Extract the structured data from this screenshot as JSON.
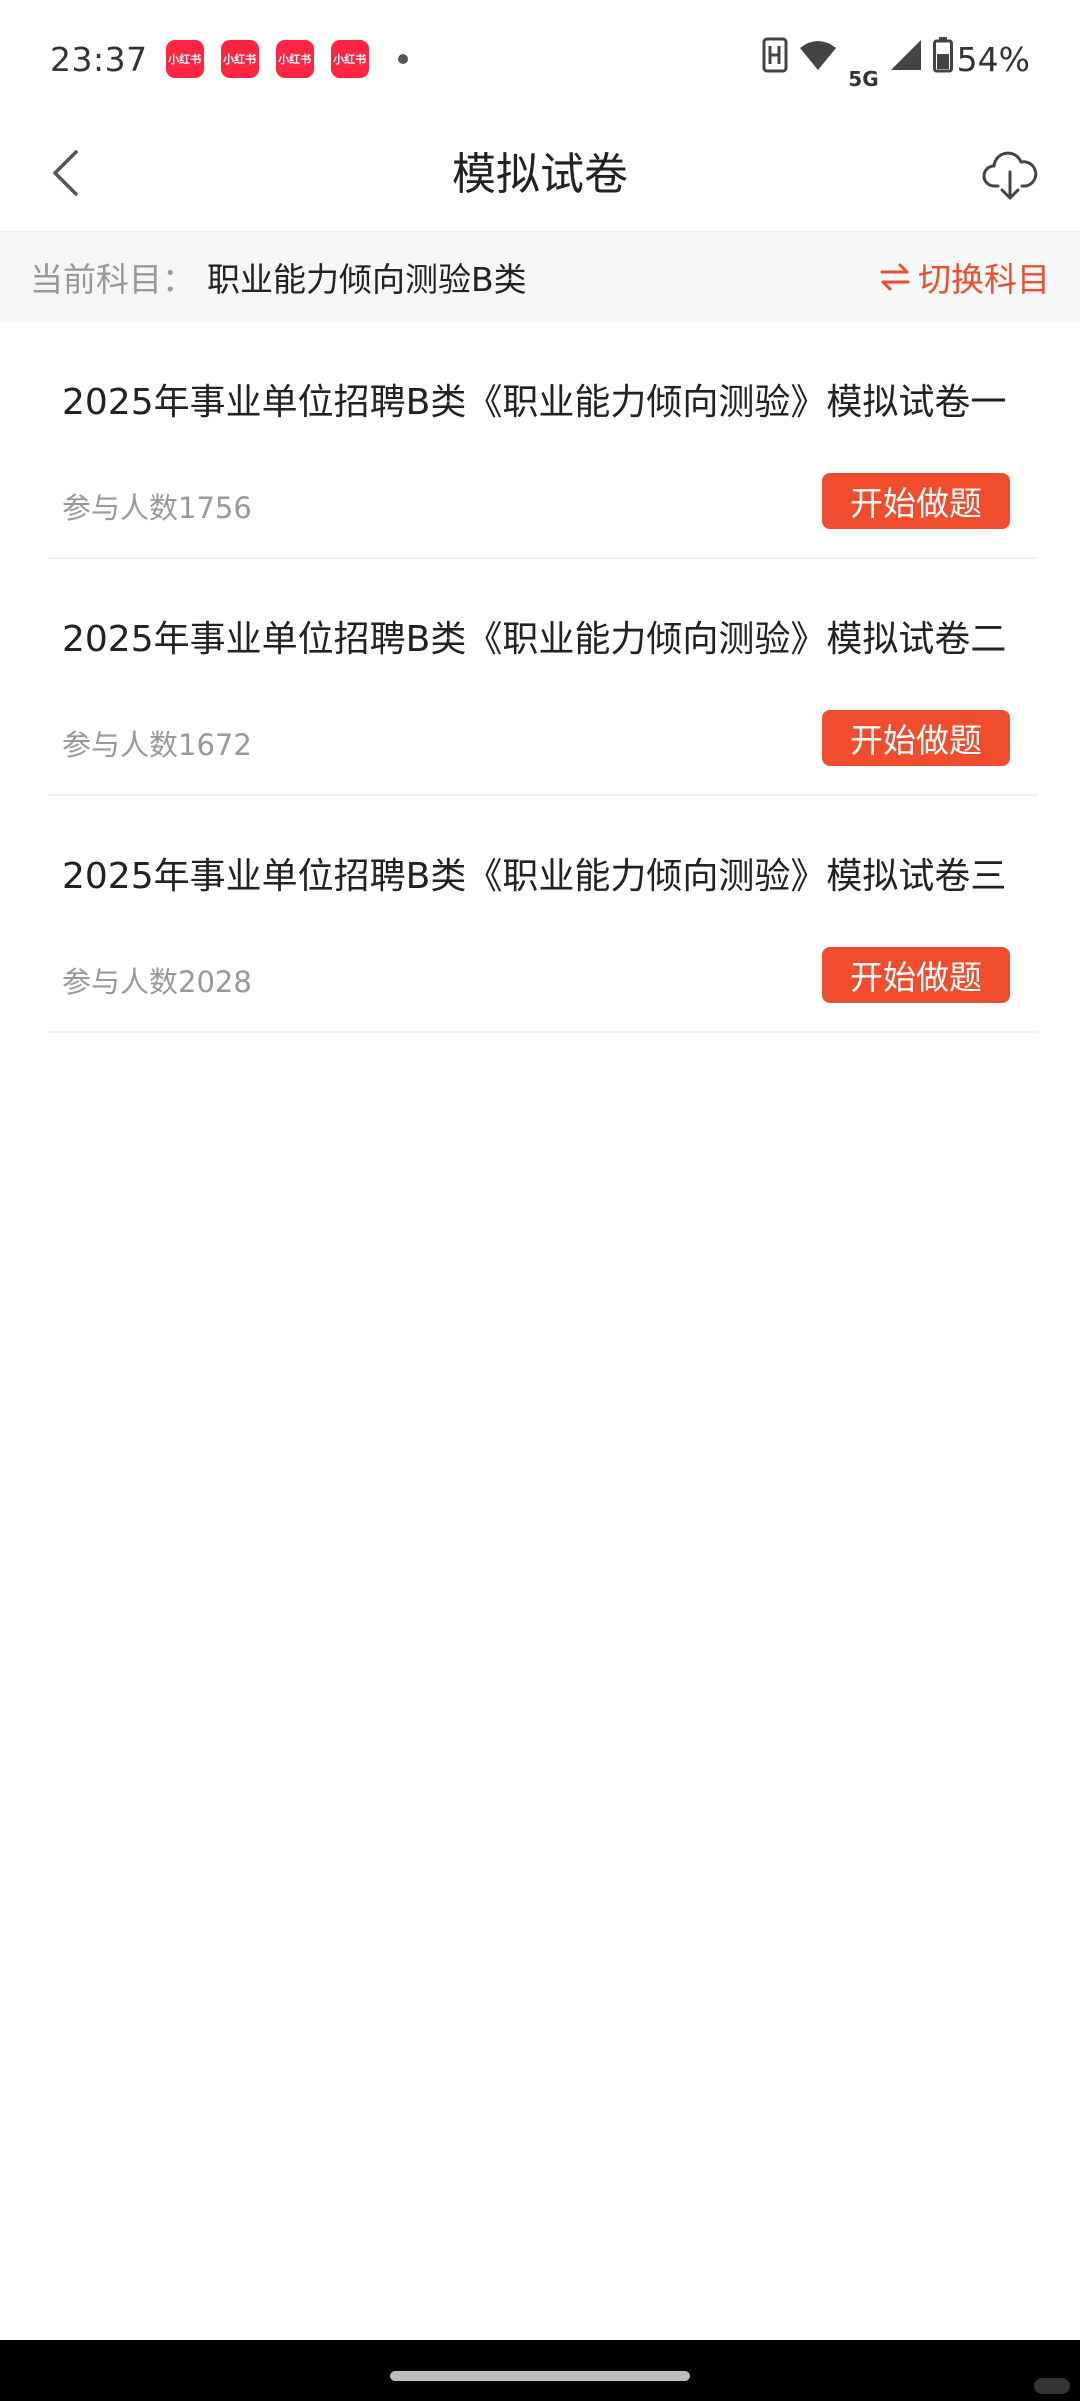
{
  "status_bar": {
    "time": "23:37",
    "notifications": [
      "小红书",
      "小红书",
      "小红书",
      "小红书"
    ],
    "network": "5G",
    "battery": "54%"
  },
  "header": {
    "title": "模拟试卷"
  },
  "subject": {
    "label": "当前科目：",
    "value": "职业能力倾向测验B类",
    "switch_label": "切换科目"
  },
  "papers": [
    {
      "title": "2025年事业单位招聘B类《职业能力倾向测验》模拟试卷一",
      "participants": "参与人数1756",
      "button_label": "开始做题"
    },
    {
      "title": "2025年事业单位招聘B类《职业能力倾向测验》模拟试卷二",
      "participants": "参与人数1672",
      "button_label": "开始做题"
    },
    {
      "title": "2025年事业单位招聘B类《职业能力倾向测验》模拟试卷三",
      "participants": "参与人数2028",
      "button_label": "开始做题"
    }
  ],
  "colors": {
    "accent": "#ef4d2d",
    "muted_text": "#999999",
    "notification_badge": "#ff2442"
  },
  "icons": {
    "back": "chevron-left-icon",
    "download": "cloud-download-icon",
    "switch": "swap-arrows-icon"
  }
}
